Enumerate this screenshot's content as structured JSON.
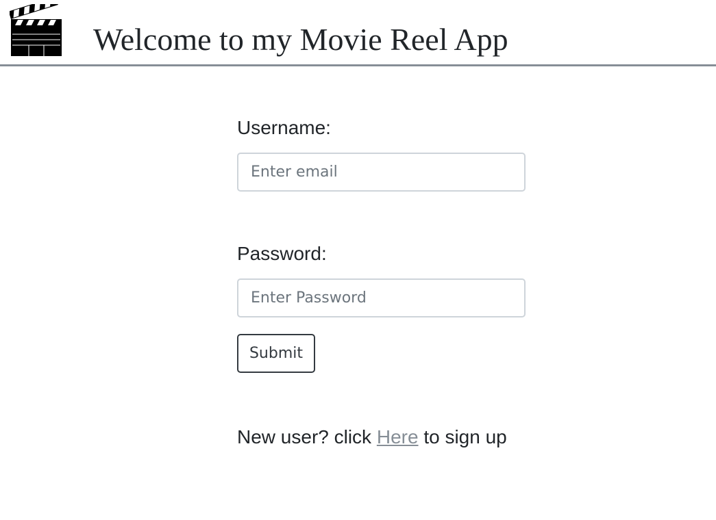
{
  "header": {
    "title": "Welcome to my Movie Reel App",
    "logo_icon": "clapperboard-icon"
  },
  "login_form": {
    "username_label": "Username:",
    "username_value": "",
    "username_placeholder": "Enter email",
    "password_label": "Password:",
    "password_value": "",
    "password_placeholder": "Enter Password",
    "submit_label": "Submit"
  },
  "signup": {
    "prefix": "New user? click",
    "link_text": "Here",
    "suffix": "to sign up"
  },
  "colors": {
    "text": "#212529",
    "header_border": "#868e96",
    "input_border": "#ced4da",
    "button_border": "#343a40",
    "link": "#868e96"
  }
}
